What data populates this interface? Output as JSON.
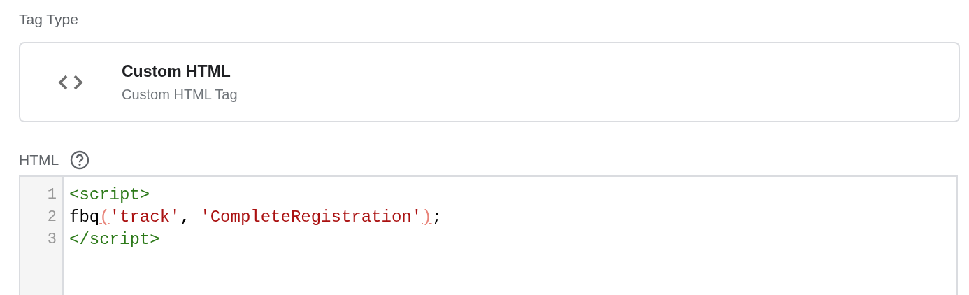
{
  "tag_type": {
    "label": "Tag Type",
    "card": {
      "title": "Custom HTML",
      "subtitle": "Custom HTML Tag"
    }
  },
  "html": {
    "label": "HTML",
    "lines": [
      {
        "number": "1",
        "tokens": [
          {
            "kind": "tag",
            "text": "<script>"
          }
        ]
      },
      {
        "number": "2",
        "tokens": [
          {
            "kind": "plain",
            "text": "fbq"
          },
          {
            "kind": "bracket",
            "text": "("
          },
          {
            "kind": "string",
            "text": "'track'"
          },
          {
            "kind": "plain",
            "text": ", "
          },
          {
            "kind": "string",
            "text": "'CompleteRegistration'"
          },
          {
            "kind": "bracket",
            "text": ")"
          },
          {
            "kind": "plain",
            "text": ";"
          }
        ]
      },
      {
        "number": "3",
        "tokens": [
          {
            "kind": "tag",
            "text": "</script>"
          }
        ]
      }
    ]
  }
}
